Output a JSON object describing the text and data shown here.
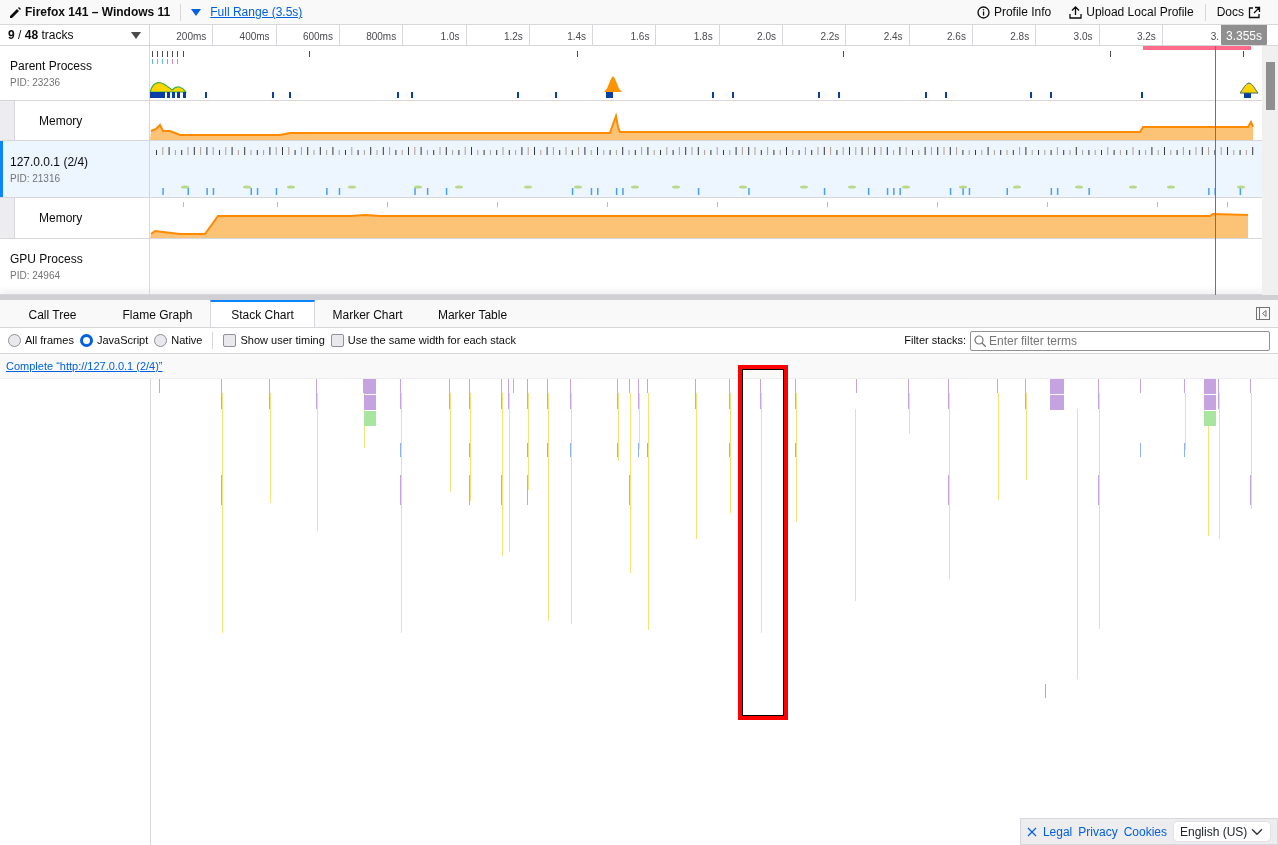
{
  "header": {
    "title": "Firefox 141 – Windows 11",
    "range": "Full Range (3.5s)",
    "actions": [
      {
        "label": "Profile Info",
        "kind": "info"
      },
      {
        "label": "Upload Local Profile",
        "kind": "upload"
      },
      {
        "label": "Docs",
        "kind": "docs"
      }
    ]
  },
  "timeline": {
    "track_count": "**9** / **48** tracks",
    "ticks": [
      "200ms",
      "400ms",
      "600ms",
      "800ms",
      "1.0s",
      "1.2s",
      "1.4s",
      "1.6s",
      "1.8s",
      "2.0s",
      "2.2s",
      "2.4s",
      "2.6s",
      "2.8s",
      "3.0s",
      "3.2s",
      "3."
    ],
    "hover_time": "3.355s",
    "tracks": [
      {
        "kind": "process",
        "name": "Parent Process",
        "pid": "PID: 23236",
        "selected": false
      },
      {
        "kind": "memory",
        "name": "Memory",
        "selected": false
      },
      {
        "kind": "process",
        "name": "127.0.0.1 (2/4)",
        "pid": "PID: 21316",
        "selected": true
      },
      {
        "kind": "memory",
        "name": "Memory",
        "selected": false
      },
      {
        "kind": "process",
        "name": "GPU Process",
        "pid": "PID: 24964",
        "selected": false
      }
    ]
  },
  "tabs": [
    {
      "label": "Call Tree",
      "selected": false
    },
    {
      "label": "Flame Graph",
      "selected": false
    },
    {
      "label": "Stack Chart",
      "selected": true
    },
    {
      "label": "Marker Chart",
      "selected": false
    },
    {
      "label": "Marker Table",
      "selected": false
    }
  ],
  "settings": {
    "frames": [
      {
        "label": "All frames",
        "selected": false
      },
      {
        "label": "JavaScript",
        "selected": true
      },
      {
        "label": "Native",
        "selected": false
      }
    ],
    "options": [
      {
        "label": "Show user timing",
        "checked": false
      },
      {
        "label": "Use the same width for each stack",
        "checked": false
      }
    ],
    "filter_label": "Filter stacks:",
    "filter_placeholder": "Enter filter terms"
  },
  "breadcrumb": "Complete “http://127.0.0.1 (2/4)”",
  "footer": {
    "links": [
      "Legal",
      "Privacy",
      "Cookies"
    ],
    "language": "English (US)"
  }
}
